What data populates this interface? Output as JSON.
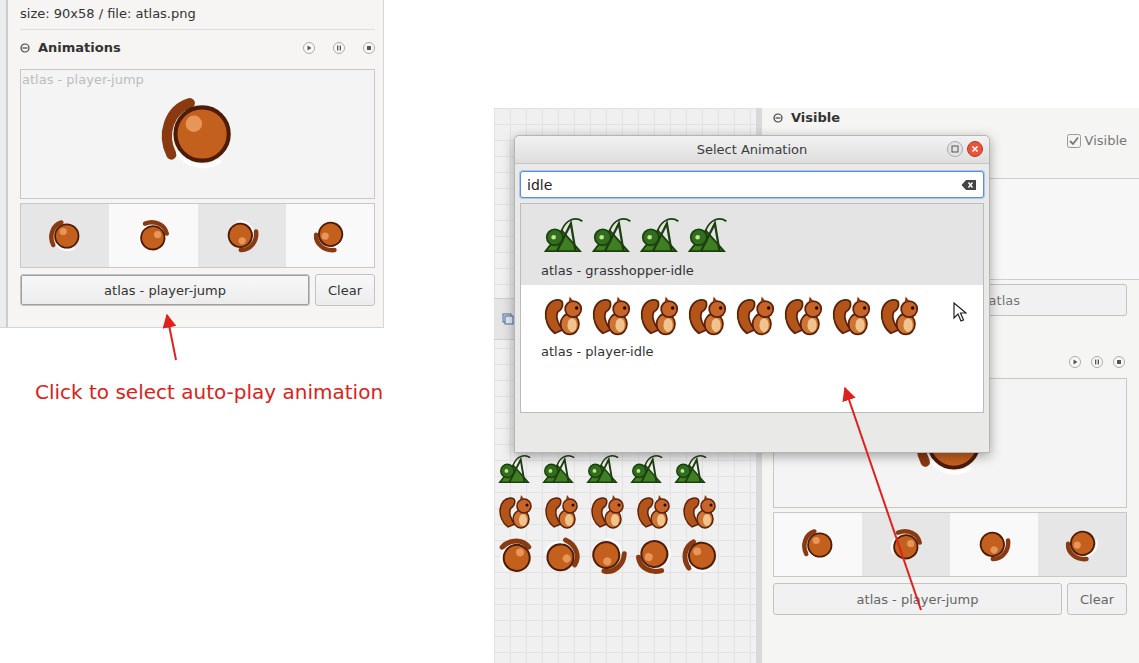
{
  "left_panel": {
    "info": "size: 90x58 / file: atlas.png",
    "section": {
      "title": "Animations",
      "expanded": true
    },
    "preview_label": "atlas - player-jump",
    "select_button": "atlas - player-jump",
    "clear_button": "Clear"
  },
  "annotation": {
    "text": "Click to select auto-play animation"
  },
  "right_panel": {
    "section": {
      "title": "Visible",
      "expanded": true
    },
    "checkbox": {
      "label": "Visible",
      "checked": true
    },
    "hidden_button": "atlas",
    "select_button": "atlas - player-jump",
    "clear_button": "Clear"
  },
  "dialog": {
    "title": "Select Animation",
    "search": {
      "value": "idle"
    },
    "items": [
      {
        "label": "atlas - grasshopper-idle",
        "selected": true,
        "sprite": "hopper",
        "frames": 4
      },
      {
        "label": "atlas - player-idle",
        "selected": false,
        "sprite": "squirrel",
        "frames": 8
      }
    ]
  }
}
